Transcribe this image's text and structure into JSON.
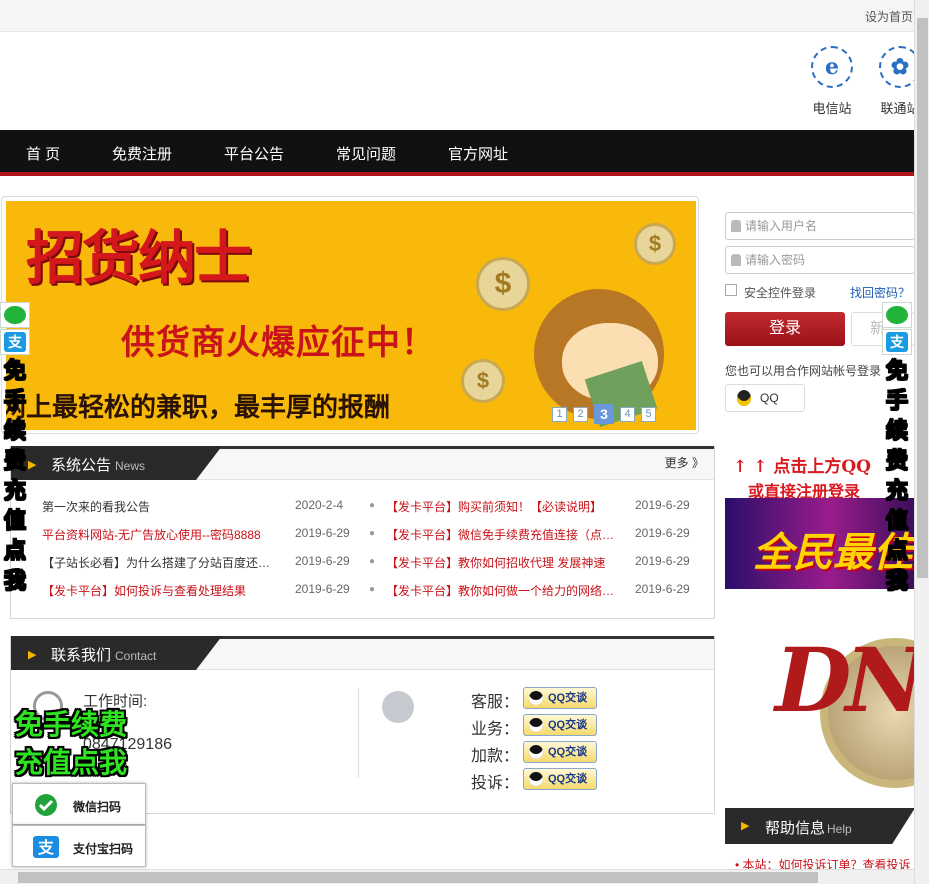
{
  "topbar": {
    "set_home": "设为首页"
  },
  "header": {
    "telecom": {
      "label": "电信站",
      "glyph": "e"
    },
    "unicom": {
      "label": "联通站",
      "glyph": "✿"
    }
  },
  "nav": {
    "items": [
      "首 页",
      "免费注册",
      "平台公告",
      "常见问题",
      "官方网址"
    ]
  },
  "banner": {
    "title": "招货纳士",
    "line1": "供货商火爆应征中！",
    "line2": "网上最轻松的兼职，最丰厚的报酬",
    "coin_symbol": "$",
    "slides": [
      "1",
      "2",
      "3",
      "4",
      "5"
    ],
    "active_slide": "3"
  },
  "news": {
    "title": "系统公告",
    "subtitle": "News",
    "more": "更多 》",
    "left": [
      {
        "title": "第一次来的看我公告",
        "date": "2020-2-4",
        "color": "#333333"
      },
      {
        "title": "平台资料网站-无广告放心使用--密码8888",
        "date": "2019-6-29",
        "color": "#c9121a"
      },
      {
        "title": "【子站长必看】为什么搭建了分站百度还…",
        "date": "2019-6-29",
        "color": "#333333"
      },
      {
        "title": "【发卡平台】如何投诉与查看处理结果",
        "date": "2019-6-29",
        "color": "#c9121a"
      }
    ],
    "right": [
      {
        "title": "【发卡平台】购买前须知！【必读说明】",
        "date": "2019-6-29"
      },
      {
        "title": "【发卡平台】微信免手续费充值连接（点…",
        "date": "2019-6-29"
      },
      {
        "title": "【发卡平台】教你如何招收代理 发展神速",
        "date": "2019-6-29"
      },
      {
        "title": "【发卡平台】教你如何做一个给力的网络…",
        "date": "2019-6-29"
      }
    ]
  },
  "contact": {
    "title": "联系我们",
    "subtitle": "Contact",
    "work_time_label": "工作时间:",
    "phone": "0847129186",
    "rows": [
      {
        "label": "客服：",
        "btn": "QQ交谈"
      },
      {
        "label": "业务：",
        "btn": "QQ交谈"
      },
      {
        "label": "加款：",
        "btn": "QQ交谈"
      },
      {
        "label": "投诉：",
        "btn": "QQ交谈"
      }
    ]
  },
  "login": {
    "username_placeholder": "请输入用户名",
    "password_placeholder": "请输入密码",
    "secure_login": "安全控件登录",
    "forgot": "找回密码？",
    "login_btn": "登录",
    "register_btn": "新",
    "partner_text": "您也可以用合作网站帐号登录",
    "qq_btn": "QQ"
  },
  "hints": {
    "line1": "↑ ↑ 点击上方QQ",
    "line2": "或直接注册登录"
  },
  "promo": {
    "text1": "全民最佳",
    "text2": "DNF"
  },
  "help": {
    "title": "帮助信息",
    "subtitle": "Help",
    "first_item": "• 本站：如何投诉订单？查看投诉"
  },
  "float": {
    "vertical_text": [
      "免",
      "手",
      "续",
      "费",
      "充",
      "值",
      "点",
      "我"
    ],
    "zfb_glyph": "支",
    "big_text_1": "免手续费",
    "big_text_2": "充值点我",
    "wechat_scan": "微信扫码",
    "alipay_scan": "支付宝扫码"
  },
  "colors": {
    "accent_red": "#c9121a",
    "nav_bg": "#111111",
    "banner_bg": "#f9b90a",
    "float_green": "#1fe41f"
  }
}
